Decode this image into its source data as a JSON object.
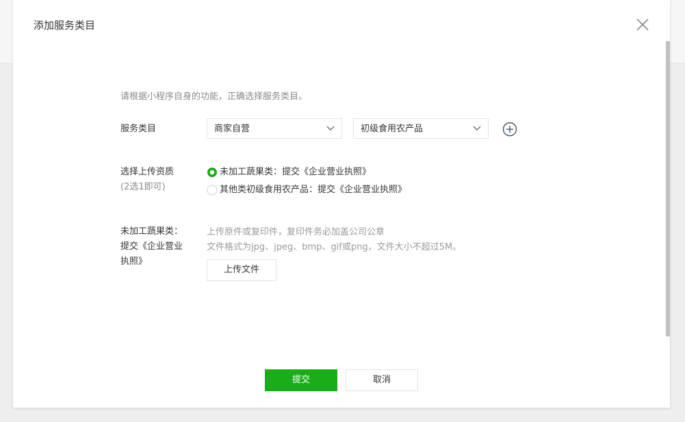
{
  "dialog": {
    "title": "添加服务类目"
  },
  "hint": "请根据小程序自身的功能，正确选择服务类目。",
  "category": {
    "label": "服务类目",
    "primary_value": "商家自营",
    "secondary_value": "初级食用农产品"
  },
  "qualification": {
    "label": "选择上传资质",
    "sub_label": "(2选1即可)",
    "options": [
      {
        "text": "未加工蔬果类：提交《企业营业执照》",
        "selected": true
      },
      {
        "text": "其他类初级食用农产品：提交《企业营业执照》",
        "selected": false
      }
    ]
  },
  "upload": {
    "label": "未加工蔬果类：提交《企业营业执照》",
    "tip_line1": "上传原件或复印件，复印件务必加盖公司公章",
    "tip_line2": "文件格式为jpg、jpeg、bmp、gif或png，文件大小不超过5M。",
    "button_label": "上传文件"
  },
  "footer": {
    "submit_label": "提交",
    "cancel_label": "取消"
  },
  "colors": {
    "accent": "#1aad19",
    "border": "#e2e2e2"
  },
  "icons": {
    "close": "close-icon",
    "chevron": "chevron-down-icon",
    "add": "plus-circle-icon"
  }
}
